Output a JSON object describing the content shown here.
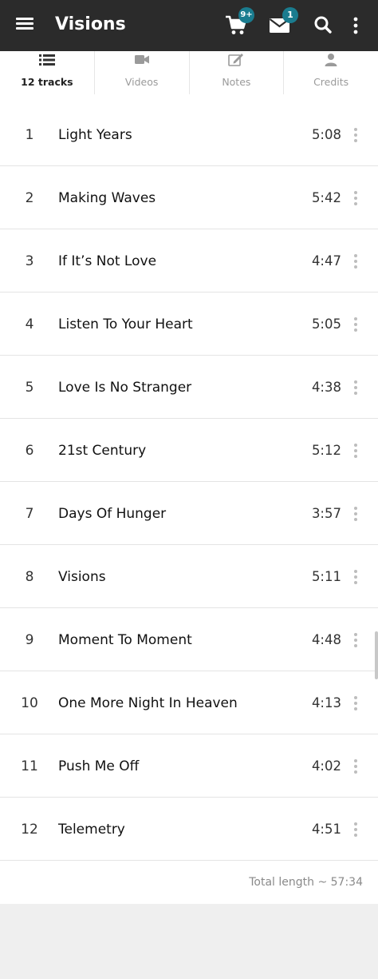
{
  "app": {
    "title": "Visions",
    "cart_badge": "9+",
    "mail_badge": "1",
    "accent_color": "#1a7c8f",
    "bar_color": "#2b2b2b"
  },
  "tabs": [
    {
      "label": "12 tracks",
      "icon": "list-icon",
      "active": true
    },
    {
      "label": "Videos",
      "icon": "video-camera-icon",
      "active": false
    },
    {
      "label": "Notes",
      "icon": "edit-note-icon",
      "active": false
    },
    {
      "label": "Credits",
      "icon": "person-icon",
      "active": false
    }
  ],
  "tracks": [
    {
      "number": "1",
      "title": "Light Years",
      "length": "5:08"
    },
    {
      "number": "2",
      "title": "Making Waves",
      "length": "5:42"
    },
    {
      "number": "3",
      "title": "If It’s Not Love",
      "length": "4:47"
    },
    {
      "number": "4",
      "title": "Listen To Your Heart",
      "length": "5:05"
    },
    {
      "number": "5",
      "title": "Love Is No Stranger",
      "length": "4:38"
    },
    {
      "number": "6",
      "title": "21st Century",
      "length": "5:12"
    },
    {
      "number": "7",
      "title": "Days Of Hunger",
      "length": "3:57"
    },
    {
      "number": "8",
      "title": "Visions",
      "length": "5:11"
    },
    {
      "number": "9",
      "title": "Moment To Moment",
      "length": "4:48"
    },
    {
      "number": "10",
      "title": "One More Night In Heaven",
      "length": "4:13"
    },
    {
      "number": "11",
      "title": "Push Me Off",
      "length": "4:02"
    },
    {
      "number": "12",
      "title": "Telemetry",
      "length": "4:51"
    }
  ],
  "total_length": "Total length ~ 57:34"
}
